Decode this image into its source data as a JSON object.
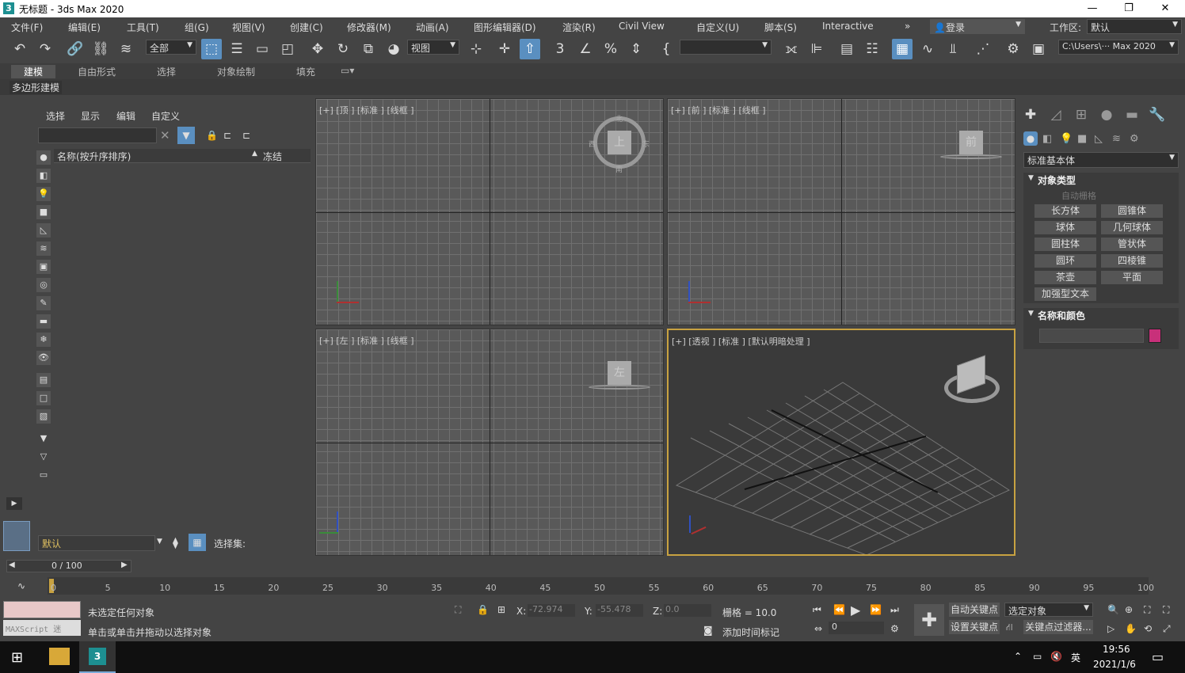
{
  "window": {
    "title": "无标题 - 3ds Max 2020",
    "app_icon": "3",
    "minimize": "—",
    "maximize": "❐",
    "close": "✕"
  },
  "menu": [
    "文件(F)",
    "编辑(E)",
    "工具(T)",
    "组(G)",
    "视图(V)",
    "创建(C)",
    "修改器(M)",
    "动画(A)",
    "图形编辑器(D)",
    "渲染(R)",
    "Civil View",
    "自定义(U)",
    "脚本(S)",
    "Interactive"
  ],
  "menu_more": "»",
  "login": "登录",
  "workspace_label": "工作区:",
  "workspace_value": "默认",
  "toolbar": {
    "selection_filter": "全部",
    "ref_coord": "视图",
    "named_sel": "",
    "project_path": "C:\\Users\\··· Max 2020"
  },
  "ribbon_tabs": [
    "建模",
    "自由形式",
    "选择",
    "对象绘制",
    "填充"
  ],
  "sub_ribbon": "多边形建模",
  "explorer": {
    "tabs": [
      "选择",
      "显示",
      "编辑",
      "自定义"
    ],
    "search_placeholder": "",
    "col_name": "名称(按升序排序)",
    "col_frozen": "冻结",
    "sort_arrow": "▲",
    "layer": "默认",
    "selection_set": "选择集:"
  },
  "viewports": [
    {
      "label": "[+] [顶 ] [标准 ] [线框 ]",
      "cube": "上",
      "compass": [
        "北",
        "南",
        "东",
        "西"
      ]
    },
    {
      "label": "[+] [前 ] [标准 ] [线框 ]",
      "cube": "前"
    },
    {
      "label": "[+] [左 ] [标准 ] [线框 ]",
      "cube": "左"
    },
    {
      "label": "[+] [透视 ] [标准 ] [默认明暗处理 ]",
      "cube": ""
    }
  ],
  "command_panel": {
    "category": "标准基本体",
    "rollout_object_type": "对象类型",
    "auto_grid": "自动栅格",
    "objects": [
      "长方体",
      "圆锥体",
      "球体",
      "几何球体",
      "圆柱体",
      "管状体",
      "圆环",
      "四棱锥",
      "茶壶",
      "平面",
      "加强型文本"
    ],
    "rollout_name_color": "名称和颜色",
    "name_value": "",
    "color": "#c8307a"
  },
  "timeline": {
    "frame": "0 / 100",
    "ticks": [
      "0",
      "5",
      "10",
      "15",
      "20",
      "25",
      "30",
      "35",
      "40",
      "45",
      "50",
      "55",
      "60",
      "65",
      "70",
      "75",
      "80",
      "85",
      "90",
      "95",
      "100"
    ]
  },
  "status": {
    "maxscript": "MAXScript 迷",
    "line1": "未选定任何对象",
    "line2": "单击或单击并拖动以选择对象",
    "x_label": "X:",
    "x": "-72.974",
    "y_label": "Y:",
    "y": "-55.478",
    "z_label": "Z:",
    "z": "0.0",
    "grid": "栅格 = 10.0",
    "add_time_tag": "添加时间标记",
    "auto_key": "自动关键点",
    "set_key": "设置关键点",
    "sel_obj": "选定对象",
    "key_filter": "关键点过滤器...",
    "frame_field": "0"
  },
  "taskbar": {
    "time": "19:56",
    "date": "2021/1/6",
    "lang": "英"
  }
}
